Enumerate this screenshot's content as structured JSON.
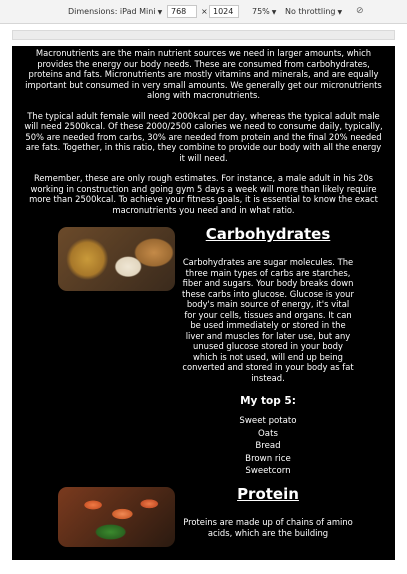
{
  "devtools": {
    "dimensions_label": "Dimensions: iPad Mini",
    "width": "768",
    "times": "×",
    "height": "1024",
    "zoom": "75%",
    "throttling": "No throttling",
    "rotate_icon": "rotate-icon"
  },
  "intro": {
    "p1": "Macronutrients are the main nutrient sources we need in larger amounts, which provides the energy our body needs. These are consumed from carbohydrates, proteins and fats. Micronutrients are mostly vitamins and minerals, and are equally important but consumed in very small amounts. We generally get our micronutrients along with macronutrients.",
    "p2": "The typical adult female will need 2000kcal per day, whereas the typical adult male will need 2500kcal. Of these 2000/2500 calories we need to consume daily, typically, 50% are needed from carbs, 30% are needed from protein and the final 20% needed are fats. Together, in this ratio, they combine to provide our body with all the energy it will need.",
    "p3": "Remember, these are only rough estimates. For instance, a male adult in his 20s working in construction and going gym 5 days a week will more than likely require more than 2500kcal. To achieve your fitness goals, it is essential to know the exact macronutrients you need and in what ratio."
  },
  "carbs": {
    "title": "Carbohydrates",
    "body": "Carbohydrates are sugar molecules. The three main types of carbs are starches, fiber and sugars. Your body breaks down these carbs into glucose. Glucose is your body's main source of energy, it's vital for your cells, tissues and organs. It can be used immediately or stored in the liver and muscles for later use, but any unused glucose stored in your body which is not used, will end up being converted and stored in your body as fat instead.",
    "top5_heading": "My top 5:",
    "top5": [
      "Sweet potato",
      "Oats",
      "Bread",
      "Brown rice",
      "Sweetcorn"
    ]
  },
  "protein": {
    "title": "Protein",
    "body": "Proteins are made up of chains of amino acids, which are the building"
  }
}
